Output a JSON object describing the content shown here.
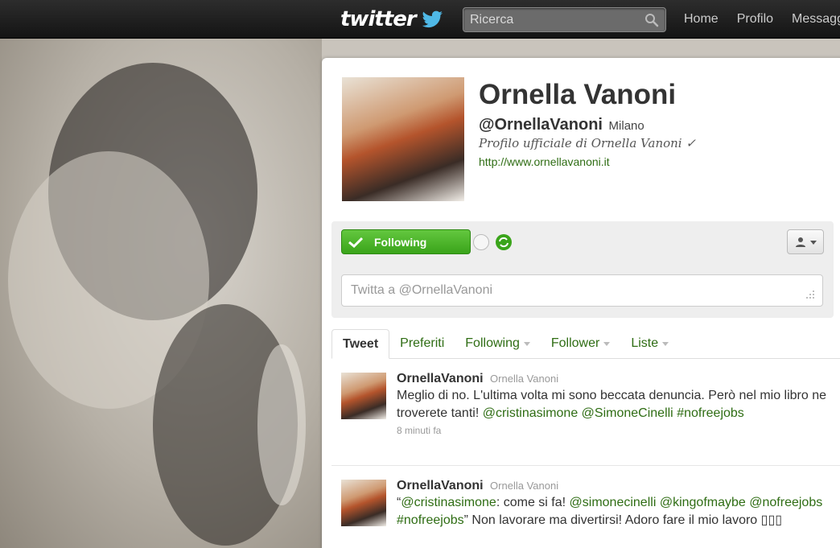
{
  "topbar": {
    "logo_text": "twitter",
    "search_placeholder": "Ricerca",
    "nav": [
      "Home",
      "Profilo",
      "Messaggi"
    ]
  },
  "profile": {
    "name": "Ornella Vanoni",
    "handle": "@OrnellaVanoni",
    "location": "Milano",
    "bio": "Profilo ufficiale di Ornella Vanoni ✓",
    "url": "http://www.ornellavanoni.it"
  },
  "actions": {
    "follow_label": "Following",
    "tweet_to_placeholder": "Twitta a @OrnellaVanoni"
  },
  "tabs": [
    {
      "label": "Tweet",
      "active": true,
      "dropdown": false
    },
    {
      "label": "Preferiti",
      "active": false,
      "dropdown": false
    },
    {
      "label": "Following",
      "active": false,
      "dropdown": true
    },
    {
      "label": "Follower",
      "active": false,
      "dropdown": true
    },
    {
      "label": "Liste",
      "active": false,
      "dropdown": true
    }
  ],
  "tweets": [
    {
      "user": "OrnellaVanoni",
      "name": "Ornella Vanoni",
      "parts": [
        {
          "t": "Meglio di no. L'ultima volta mi sono beccata denuncia. Però nel mio libro ne troverete tanti! ",
          "hl": false
        },
        {
          "t": "@cristinasimone",
          "hl": true
        },
        {
          "t": " ",
          "hl": false
        },
        {
          "t": "@SimoneCinelli",
          "hl": true
        },
        {
          "t": " ",
          "hl": false
        },
        {
          "t": "#nofreejobs",
          "hl": true
        }
      ],
      "time": "8 minuti fa"
    },
    {
      "user": "OrnellaVanoni",
      "name": "Ornella Vanoni",
      "parts": [
        {
          "t": "“",
          "hl": false
        },
        {
          "t": "@cristinasimone",
          "hl": true
        },
        {
          "t": ": come si fa! ",
          "hl": false
        },
        {
          "t": "@simonecinelli",
          "hl": true
        },
        {
          "t": " ",
          "hl": false
        },
        {
          "t": "@kingofmaybe",
          "hl": true
        },
        {
          "t": " ",
          "hl": false
        },
        {
          "t": "@nofreejobs",
          "hl": true
        },
        {
          "t": " ",
          "hl": false
        },
        {
          "t": "#nofreejobs",
          "hl": true
        },
        {
          "t": "” Non lavorare ma divertirsi! Adoro fare il mio lavoro ▯▯▯",
          "hl": false
        }
      ],
      "time": ""
    }
  ],
  "colors": {
    "link": "#2f6d14",
    "follow_green": "#3aa41a",
    "topbar": "#1e1e1e"
  }
}
